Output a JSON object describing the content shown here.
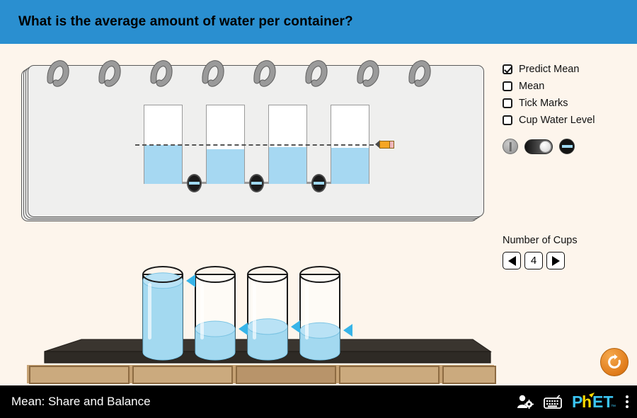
{
  "header": {
    "question": "What is the average amount of water per container?",
    "background_color": "#2a8fd0"
  },
  "colors": {
    "screen_background": "#fdf5ec",
    "water": "#a6d8f2",
    "water_3d": "#a3d9f0",
    "pointer": "#37b4e8",
    "notebook_page": "#efefee",
    "table_top": "#3a352f",
    "drawer": "#c6a274",
    "reset_orange": "#e8861e",
    "phet_cyan": "#3bc4f2",
    "phet_yellow": "#fcd900"
  },
  "controls": {
    "checkboxes": [
      {
        "label": "Predict Mean",
        "checked": true
      },
      {
        "label": "Mean",
        "checked": false
      },
      {
        "label": "Tick Marks",
        "checked": false
      },
      {
        "label": "Cup Water Level",
        "checked": false
      }
    ],
    "pipe_toggle": {
      "closed_icon": "pipe-closed-icon",
      "open_icon": "pipe-open-icon",
      "state": "open"
    }
  },
  "number_of_cups": {
    "label": "Number of Cups",
    "value": "4",
    "decrement_icon": "triangle-left-icon",
    "increment_icon": "triangle-right-icon"
  },
  "notebook": {
    "spiral_ring_count": 8,
    "predict_mean_line_value": 0.5,
    "pencil_icon": "pencil-icon",
    "bars": [
      {
        "name": "bar-cup-1",
        "fill": 0.5
      },
      {
        "name": "bar-cup-2",
        "fill": 0.44
      },
      {
        "name": "bar-cup-3",
        "fill": 0.47
      },
      {
        "name": "bar-cup-4",
        "fill": 0.46
      }
    ],
    "pipes": [
      {
        "name": "pipe-1",
        "open": true
      },
      {
        "name": "pipe-2",
        "open": true
      },
      {
        "name": "pipe-3",
        "open": true
      }
    ]
  },
  "table_cups": [
    {
      "name": "table-cup-1",
      "fill": 0.92
    },
    {
      "name": "table-cup-2",
      "fill": 0.3
    },
    {
      "name": "table-cup-3",
      "fill": 0.33
    },
    {
      "name": "table-cup-4",
      "fill": 0.28
    }
  ],
  "reset": {
    "icon": "reset-all-icon",
    "tooltip": "Reset All"
  },
  "navbar": {
    "title": "Mean: Share and Balance",
    "preferences_icon": "person-gear-icon",
    "keyboard_icon": "keyboard-shortcuts-icon",
    "logo_text": "PhET",
    "menu_icon": "kebab-menu-icon"
  }
}
